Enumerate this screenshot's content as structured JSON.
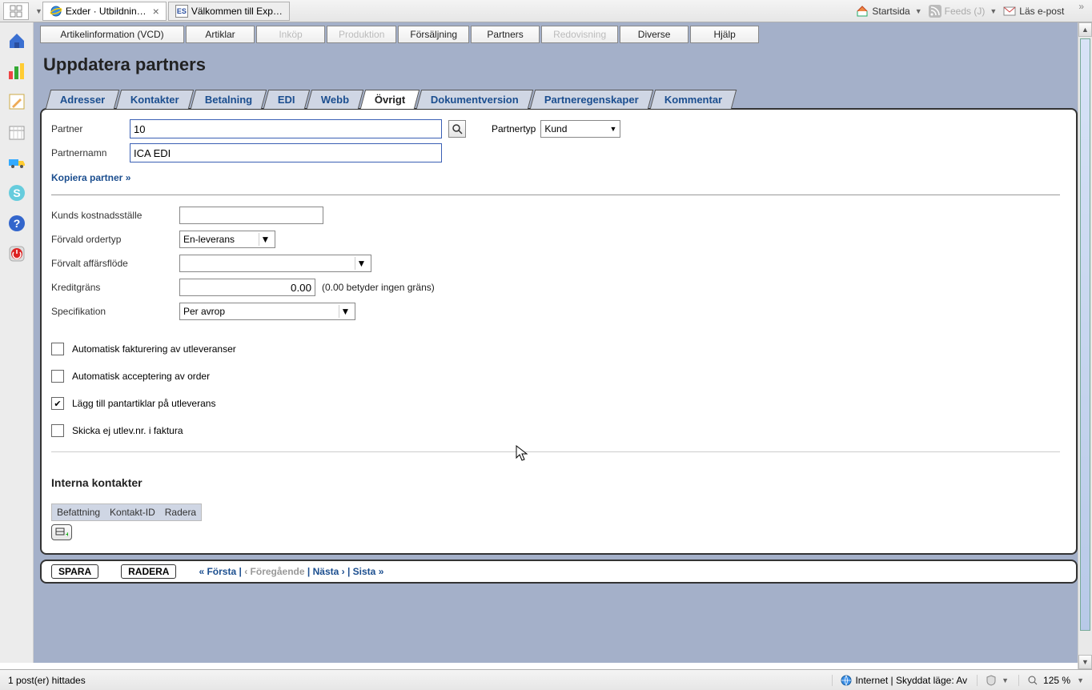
{
  "browser": {
    "tabs": [
      {
        "title": "Exder · Utbildnin…",
        "active": true
      },
      {
        "title": "Välkommen till Exp…",
        "active": false
      }
    ],
    "favicon_es": "ES",
    "right_links": {
      "home": "Startsida",
      "feeds": "Feeds (J)",
      "mail": "Läs e-post"
    }
  },
  "top_menu": {
    "title_item": "Artikelinformation (VCD)",
    "items": [
      {
        "label": "Artiklar",
        "disabled": false
      },
      {
        "label": "Inköp",
        "disabled": true
      },
      {
        "label": "Produktion",
        "disabled": true
      },
      {
        "label": "Försäljning",
        "disabled": false
      },
      {
        "label": "Partners",
        "disabled": false
      },
      {
        "label": "Redovisning",
        "disabled": true
      },
      {
        "label": "Diverse",
        "disabled": false
      },
      {
        "label": "Hjälp",
        "disabled": false
      }
    ]
  },
  "page": {
    "title": "Uppdatera partners"
  },
  "tabs": [
    "Adresser",
    "Kontakter",
    "Betalning",
    "EDI",
    "Webb",
    "Övrigt",
    "Dokumentversion",
    "Partneregenskaper",
    "Kommentar"
  ],
  "active_tab": "Övrigt",
  "form": {
    "partner_label": "Partner",
    "partner_value": "10",
    "partnernamn_label": "Partnernamn",
    "partnernamn_value": "ICA EDI",
    "partnertyp_label": "Partnertyp",
    "partnertyp_value": "Kund",
    "copy_link": "Kopiera partner »",
    "kostnadsstalle_label": "Kunds kostnadsställe",
    "kostnadsstalle_value": "",
    "ordertyp_label": "Förvald ordertyp",
    "ordertyp_value": "En-leverans",
    "affarsflode_label": "Förvalt affärsflöde",
    "affarsflode_value": "",
    "kreditgrans_label": "Kreditgräns",
    "kreditgrans_value": "0.00",
    "kreditgrans_note": "(0.00 betyder ingen gräns)",
    "specifikation_label": "Specifikation",
    "specifikation_value": "Per avrop",
    "checkboxes": [
      {
        "label": "Automatisk fakturering av utleveranser",
        "checked": false
      },
      {
        "label": "Automatisk acceptering av order",
        "checked": false
      },
      {
        "label": "Lägg till pantartiklar på utleverans",
        "checked": true
      },
      {
        "label": "Skicka ej utlev.nr. i faktura",
        "checked": false
      }
    ],
    "interna_heading": "Interna kontakter",
    "table_headers": [
      "Befattning",
      "Kontakt-ID",
      "Radera"
    ]
  },
  "footer": {
    "save": "SPARA",
    "delete": "RADERA",
    "pager": {
      "first": "« Första",
      "prev": "‹ Föregående",
      "next": "Nästa ›",
      "last": "Sista »"
    }
  },
  "status": {
    "left": "1 post(er) hittades",
    "security": "Internet | Skyddat läge: Av",
    "zoom": "125 %"
  }
}
